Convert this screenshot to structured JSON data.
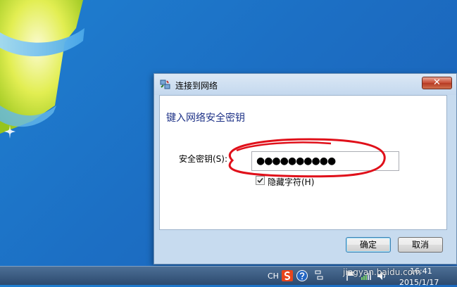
{
  "dialog": {
    "title": "连接到网络",
    "close_glyph": "✕",
    "heading": "键入网络安全密钥",
    "password_label": "安全密钥(S):",
    "password_value": "●●●●●●●●●●",
    "hide_chars_label": "隐藏字符(H)",
    "hide_chars_checked": true,
    "ok_label": "确定",
    "cancel_label": "取消"
  },
  "taskbar": {
    "language": "CH",
    "time": "16:41",
    "date": "2015/1/17",
    "icons": [
      "sogou-input-icon",
      "help-icon",
      "input-toggle-icon",
      "action-center-flag-icon",
      "network-icon",
      "volume-icon"
    ]
  },
  "watermark": "jingyan.baidu.com",
  "colors": {
    "annotation": "#e0101a",
    "heading": "#1e3287",
    "desktop": "#1c6fc4"
  }
}
